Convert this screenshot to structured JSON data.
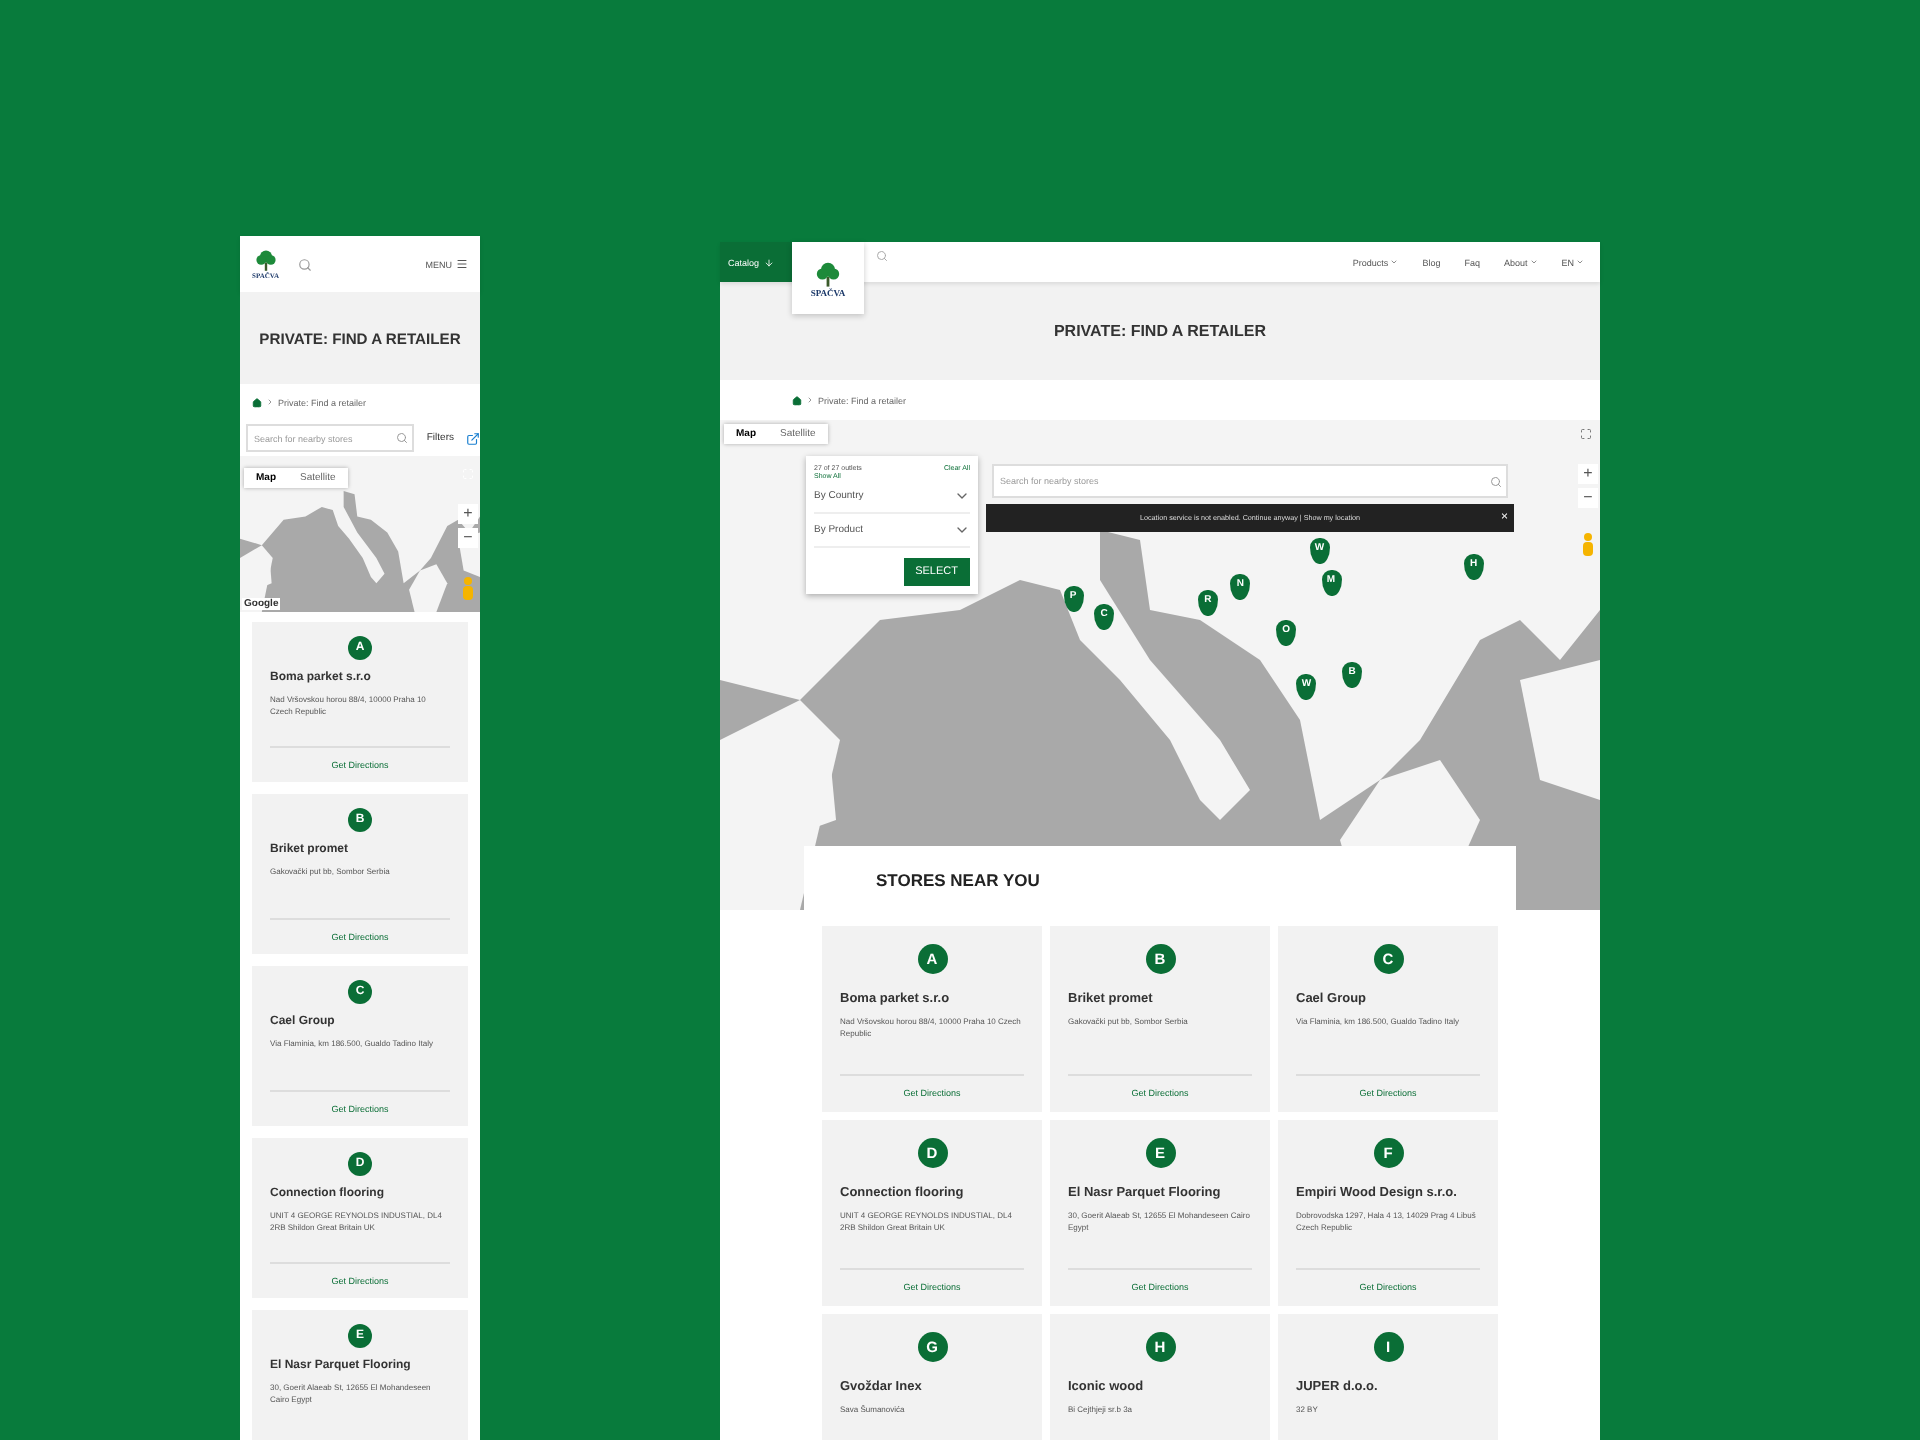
{
  "mobile": {
    "logo": "SPAČVA",
    "menu_label": "MENU",
    "title": "PRIVATE: FIND A RETAILER",
    "breadcrumb": "Private: Find a retailer",
    "search": {
      "placeholder": "Search for nearby stores"
    },
    "filters_label": "Filters",
    "map": {
      "tabs": [
        {
          "label": "Map",
          "selected": true
        },
        {
          "label": "Satellite",
          "selected": false
        }
      ],
      "zoom_in": "+",
      "zoom_out": "−",
      "attribution": "Google"
    },
    "stores": [
      {
        "letter": "A",
        "name": "Boma parket s.r.o",
        "address": "Nad Vršovskou horou 88/4, 10000 Praha 10 Czech Republic",
        "directions": "Get Directions"
      },
      {
        "letter": "B",
        "name": "Briket promet",
        "address": "Gakovački put bb, Sombor Serbia",
        "directions": "Get Directions"
      },
      {
        "letter": "C",
        "name": "Cael Group",
        "address": "Via Flaminia, km 186.500, Gualdo Tadino Italy",
        "directions": "Get Directions"
      },
      {
        "letter": "D",
        "name": "Connection flooring",
        "address": "UNIT 4 GEORGE REYNOLDS INDUSTIAL, DL4 2RB Shildon Great Britain UK",
        "directions": "Get Directions"
      },
      {
        "letter": "E",
        "name": "El Nasr Parquet Flooring",
        "address": "30, Goerit Alaeab St, 12655 El Mohandeseen Cairo Egypt"
      }
    ]
  },
  "desktop": {
    "catalog_label": "Catalog",
    "logo": "SPAČVA",
    "nav": [
      {
        "label": "Products",
        "dropdown": true
      },
      {
        "label": "Blog",
        "dropdown": false
      },
      {
        "label": "Faq",
        "dropdown": false
      },
      {
        "label": "About",
        "dropdown": true
      },
      {
        "label": "EN",
        "dropdown": true
      }
    ],
    "title": "PRIVATE: FIND A RETAILER",
    "breadcrumb": "Private: Find a retailer",
    "map": {
      "tabs": [
        {
          "label": "Map",
          "selected": true
        },
        {
          "label": "Satellite",
          "selected": false
        }
      ],
      "zoom_in": "+",
      "zoom_out": "−",
      "filter": {
        "count": "27 of 27 outlets",
        "show_all": "Show All",
        "clear_all": "Clear All",
        "selects": [
          "By Country",
          "By Product"
        ],
        "button": "SELECT"
      },
      "search": {
        "placeholder": "Search for nearby stores"
      },
      "notice": {
        "text": "Location service is not enabled. Continue anyway | Show my location",
        "close": "×"
      },
      "pins": [
        {
          "letter": "P"
        },
        {
          "letter": "C"
        },
        {
          "letter": "R"
        },
        {
          "letter": "N"
        },
        {
          "letter": "W"
        },
        {
          "letter": "M"
        },
        {
          "letter": "H"
        },
        {
          "letter": "O"
        },
        {
          "letter": "B"
        },
        {
          "letter": "W"
        }
      ]
    },
    "stores_title": "STORES NEAR YOU",
    "stores": [
      {
        "letter": "A",
        "name": "Boma parket s.r.o",
        "address": "Nad Vršovskou horou 88/4, 10000 Praha 10 Czech Republic",
        "directions": "Get Directions"
      },
      {
        "letter": "B",
        "name": "Briket promet",
        "address": "Gakovački put bb, Sombor Serbia",
        "directions": "Get Directions"
      },
      {
        "letter": "C",
        "name": "Cael Group",
        "address": "Via Flaminia, km 186.500, Gualdo Tadino Italy",
        "directions": "Get Directions"
      },
      {
        "letter": "D",
        "name": "Connection flooring",
        "address": "UNIT 4 GEORGE REYNOLDS INDUSTIAL, DL4 2RB Shildon Great Britain UK",
        "directions": "Get Directions"
      },
      {
        "letter": "E",
        "name": "El Nasr Parquet Flooring",
        "address": "30, Goerit Alaeab St, 12655 El Mohandeseen Cairo Egypt",
        "directions": "Get Directions"
      },
      {
        "letter": "F",
        "name": "Empiri Wood Design s.r.o.",
        "address": "Dobrovodska 1297, Hala 4 13, 14029 Prag 4 Libuš Czech Republic",
        "directions": "Get Directions"
      },
      {
        "letter": "G",
        "name": "Gvoždar Inex",
        "address": "Sava Šumanovića"
      },
      {
        "letter": "H",
        "name": "Iconic wood",
        "address": "Bi Cejthjeji sr.b 3a"
      },
      {
        "letter": "I",
        "name": "JUPER d.o.o.",
        "address": "32 BY"
      }
    ]
  }
}
